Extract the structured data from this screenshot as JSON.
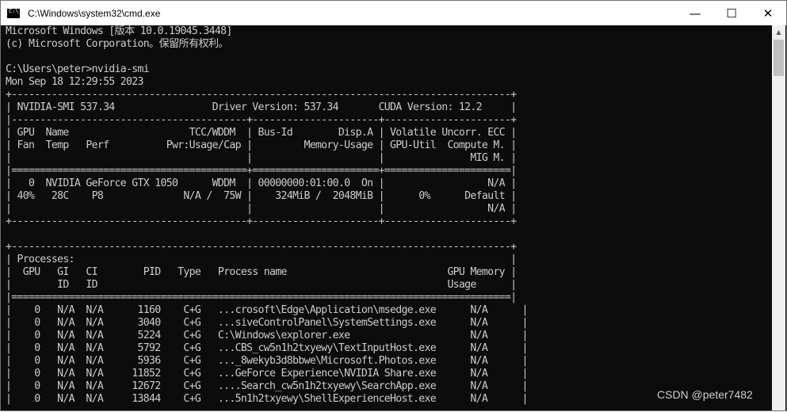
{
  "window": {
    "title": "C:\\Windows\\system32\\cmd.exe",
    "icon": "cmd-icon",
    "controls": {
      "minimize": "—",
      "maximize": "☐",
      "close": "✕"
    }
  },
  "terminal": {
    "lines": [
      "Microsoft Windows [版本 10.0.19045.3448]",
      "(c) Microsoft Corporation。保留所有权利。",
      "",
      "C:\\Users\\peter>nvidia-smi",
      "Mon Sep 18 12:29:55 2023",
      "+---------------------------------------------------------------------------------------+",
      "| NVIDIA-SMI 537.34                 Driver Version: 537.34       CUDA Version: 12.2     |",
      "|-----------------------------------------+----------------------+----------------------+",
      "| GPU  Name                     TCC/WDDM  | Bus-Id        Disp.A | Volatile Uncorr. ECC |",
      "| Fan  Temp   Perf          Pwr:Usage/Cap |         Memory-Usage | GPU-Util  Compute M. |",
      "|                                         |                      |               MIG M. |",
      "|=========================================+======================+======================|",
      "|   0  NVIDIA GeForce GTX 1050      WDDM  | 00000000:01:00.0  On |                  N/A |",
      "| 40%   28C    P8              N/A /  75W |    324MiB /  2048MiB |      0%      Default |",
      "|                                         |                      |                  N/A |",
      "+-----------------------------------------+----------------------+----------------------+",
      "",
      "+---------------------------------------------------------------------------------------+",
      "| Processes:                                                                            |",
      "|  GPU   GI   CI        PID   Type   Process name                            GPU Memory |",
      "|        ID   ID                                                             Usage      |",
      "|=======================================================================================|",
      "|    0   N/A  N/A      1160    C+G   ...crosoft\\Edge\\Application\\msedge.exe      N/A      |",
      "|    0   N/A  N/A      3040    C+G   ...siveControlPanel\\SystemSettings.exe      N/A      |",
      "|    0   N/A  N/A      5224    C+G   C:\\Windows\\explorer.exe                     N/A      |",
      "|    0   N/A  N/A      5792    C+G   ...CBS_cw5n1h2txyewy\\TextInputHost.exe      N/A      |",
      "|    0   N/A  N/A      5936    C+G   ..._8wekyb3d8bbwe\\Microsoft.Photos.exe      N/A      |",
      "|    0   N/A  N/A     11852    C+G   ...GeForce Experience\\NVIDIA Share.exe      N/A      |",
      "|    0   N/A  N/A     12672    C+G   ....Search_cw5n1h2txyewy\\SearchApp.exe      N/A      |",
      "|    0   N/A  N/A     13844    C+G   ...5n1h2txyewy\\ShellExperienceHost.exe      N/A      |"
    ]
  },
  "scrollbar": {
    "up_arrow": "▲"
  },
  "watermark": "CSDN @peter7482",
  "colors": {
    "terminal_bg": "#0c0c0c",
    "terminal_fg": "#cccccc",
    "titlebar_bg": "#ffffff"
  }
}
